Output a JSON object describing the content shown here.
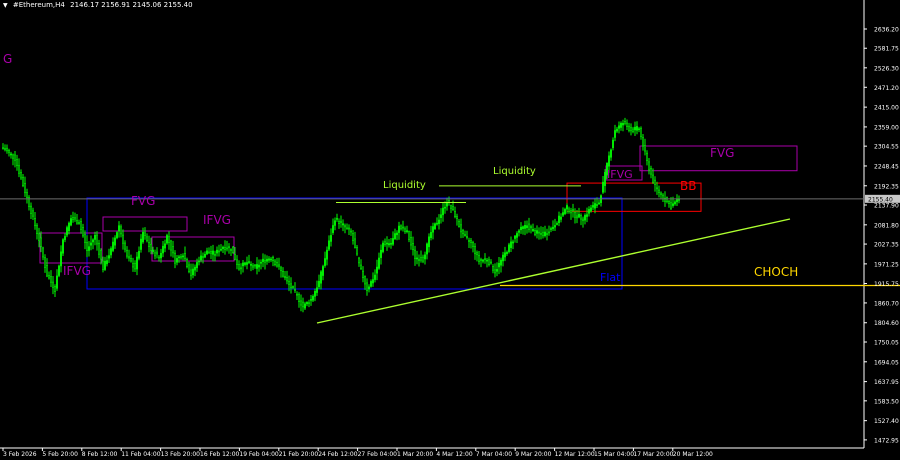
{
  "header": {
    "symbol": "#Ethereum,H4",
    "ohlc": "2146.17 2156.91 2145.06 2155.40"
  },
  "colors": {
    "bull": "#00ff00",
    "bear": "#00ff00",
    "axis": "#ffffff",
    "fvg": "#aa00aa",
    "bb": "#ff0000",
    "range": "#0000ff",
    "trend": "#adff2f",
    "liquidity": "#adff2f",
    "choch": "#ffd700",
    "current": "#6e6e6e"
  },
  "chart_data": {
    "type": "candlestick",
    "ylim": [
      1450,
      2690
    ],
    "y_ticks": [
      "2636.20",
      "2581.75",
      "2526.30",
      "2471.20",
      "2415.00",
      "2359.00",
      "2304.55",
      "2248.45",
      "2192.35",
      "2137.90",
      "2081.80",
      "2027.35",
      "1971.25",
      "1915.75",
      "1860.70",
      "1804.60",
      "1750.05",
      "1694.05",
      "1637.95",
      "1583.50",
      "1527.40",
      "1472.95"
    ],
    "x_ticks": [
      "3 Feb 2026",
      "5 Feb 20:00",
      "8 Feb 12:00",
      "11 Feb 04:00",
      "13 Feb 20:00",
      "16 Feb 12:00",
      "19 Feb 04:00",
      "21 Feb 20:00",
      "24 Feb 12:00",
      "27 Feb 04:00",
      "1 Mar 20:00",
      "4 Mar 12:00",
      "7 Mar 04:00",
      "9 Mar 20:00",
      "12 Mar 12:00",
      "15 Mar 04:00",
      "17 Mar 20:00",
      "20 Mar 12:00"
    ],
    "current_price": "2155.40",
    "current_price_value": 2155.4,
    "anchors": [
      [
        0,
        2300
      ],
      [
        6,
        2270
      ],
      [
        14,
        2120
      ],
      [
        18,
        2040
      ],
      [
        22,
        1940
      ],
      [
        26,
        1900
      ],
      [
        30,
        2040
      ],
      [
        34,
        2100
      ],
      [
        38,
        2090
      ],
      [
        42,
        2010
      ],
      [
        46,
        2050
      ],
      [
        50,
        1960
      ],
      [
        54,
        2010
      ],
      [
        58,
        2080
      ],
      [
        62,
        1990
      ],
      [
        66,
        1960
      ],
      [
        70,
        2060
      ],
      [
        74,
        2010
      ],
      [
        78,
        1990
      ],
      [
        82,
        2050
      ],
      [
        86,
        1980
      ],
      [
        90,
        2000
      ],
      [
        94,
        1940
      ],
      [
        98,
        1985
      ],
      [
        102,
        2005
      ],
      [
        106,
        2000
      ],
      [
        110,
        2020
      ],
      [
        114,
        2015
      ],
      [
        118,
        1960
      ],
      [
        122,
        1975
      ],
      [
        126,
        1960
      ],
      [
        130,
        1980
      ],
      [
        134,
        1990
      ],
      [
        138,
        1960
      ],
      [
        142,
        1920
      ],
      [
        146,
        1890
      ],
      [
        150,
        1850
      ],
      [
        154,
        1870
      ],
      [
        158,
        1920
      ],
      [
        162,
        2010
      ],
      [
        166,
        2100
      ],
      [
        170,
        2080
      ],
      [
        174,
        2060
      ],
      [
        178,
        1970
      ],
      [
        182,
        1900
      ],
      [
        186,
        1940
      ],
      [
        190,
        2030
      ],
      [
        194,
        2030
      ],
      [
        198,
        2075
      ],
      [
        202,
        2060
      ],
      [
        206,
        1990
      ],
      [
        210,
        1985
      ],
      [
        214,
        2060
      ],
      [
        218,
        2100
      ],
      [
        222,
        2150
      ],
      [
        226,
        2110
      ],
      [
        230,
        2050
      ],
      [
        234,
        2030
      ],
      [
        238,
        1980
      ],
      [
        242,
        1985
      ],
      [
        246,
        1950
      ],
      [
        250,
        1990
      ],
      [
        254,
        2030
      ],
      [
        258,
        2065
      ],
      [
        262,
        2080
      ],
      [
        266,
        2060
      ],
      [
        270,
        2055
      ],
      [
        274,
        2070
      ],
      [
        278,
        2100
      ],
      [
        282,
        2130
      ],
      [
        286,
        2110
      ],
      [
        290,
        2100
      ],
      [
        294,
        2130
      ],
      [
        298,
        2145
      ],
      [
        302,
        2250
      ],
      [
        306,
        2350
      ],
      [
        310,
        2370
      ],
      [
        314,
        2350
      ],
      [
        318,
        2355
      ],
      [
        322,
        2260
      ],
      [
        326,
        2190
      ],
      [
        330,
        2160
      ],
      [
        334,
        2135
      ],
      [
        336,
        2145
      ],
      [
        338,
        2155
      ]
    ],
    "annotations": {
      "fvg_top": {
        "label": "FVG",
        "price_top": 2305,
        "price_bottom": 2235
      },
      "fvg_left": {
        "label": "FVG"
      },
      "ifvg_mid": {
        "label": "IFVG"
      },
      "ifvg_left": {
        "label": "IFVG"
      },
      "ifvg_right": {
        "label": "IFVG"
      },
      "bb": {
        "label": "BB",
        "price_top": 2200,
        "price_bottom": 2120
      },
      "choch": {
        "label": "CHOCH",
        "price": 1910
      },
      "flat": {
        "label": "Flat",
        "price_top": 2142,
        "price_bottom": 1903
      },
      "liquidity_left": {
        "label": "Liquidity",
        "price": 2145
      },
      "liquidity_right": {
        "label": "Liquidity",
        "price": 2192
      },
      "g_left": {
        "label": "G"
      }
    }
  }
}
